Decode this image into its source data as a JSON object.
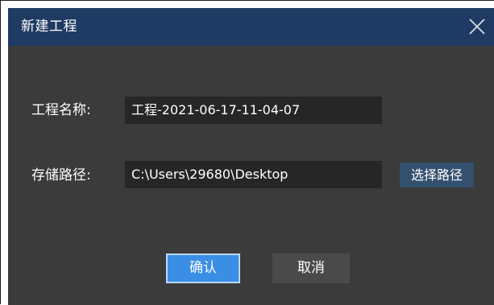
{
  "dialog": {
    "title": "新建工程",
    "close_icon": "close-icon"
  },
  "form": {
    "name_label": "工程名称:",
    "name_value": "工程-2021-06-17-11-04-07",
    "path_label": "存储路径:",
    "path_value": "C:\\Users\\29680\\Desktop",
    "choose_path_label": "选择路径"
  },
  "buttons": {
    "confirm_label": "确认",
    "cancel_label": "取消"
  },
  "colors": {
    "titlebar": "#1f3b63",
    "body": "#3b3b3b",
    "field": "#262626",
    "confirm": "#3a8ee6",
    "choose": "#34506f"
  }
}
